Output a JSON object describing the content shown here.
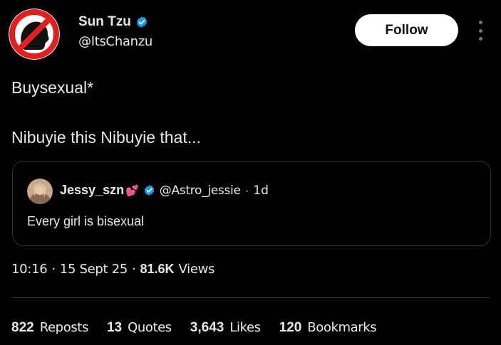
{
  "author": {
    "name": "Sun Tzu",
    "handle": "@ItsChanzu",
    "verified": true
  },
  "follow_button": {
    "label": "Follow"
  },
  "tweet": {
    "line1": "Buysexual*",
    "line2": "Nibuyie this Nibuyie that..."
  },
  "quoted_tweet": {
    "name": "Jessy_szn",
    "emoji": "💕",
    "handle": "@Astro_jessie",
    "separator": "·",
    "time": "1d",
    "text": "Every girl is bisexual"
  },
  "meta": {
    "time": "10:16",
    "sep1": "·",
    "date": "15 Sept 25",
    "sep2": "·",
    "views_count": "81.6K",
    "views_label": "Views"
  },
  "stats": [
    {
      "count": "822",
      "label": "Reposts"
    },
    {
      "count": "13",
      "label": "Quotes"
    },
    {
      "count": "3,643",
      "label": "Likes"
    },
    {
      "count": "120",
      "label": "Bookmarks"
    }
  ],
  "colors": {
    "background": "#000000",
    "text": "#e7e9ea",
    "verified_blue": "#1d9bf0",
    "border": "#2f3336",
    "no_sign_red": "#e0201f"
  },
  "icons": {
    "avatar": "no-symbol-silhouette-icon",
    "verified": "verified-badge-icon",
    "more": "more-vertical-icon"
  }
}
